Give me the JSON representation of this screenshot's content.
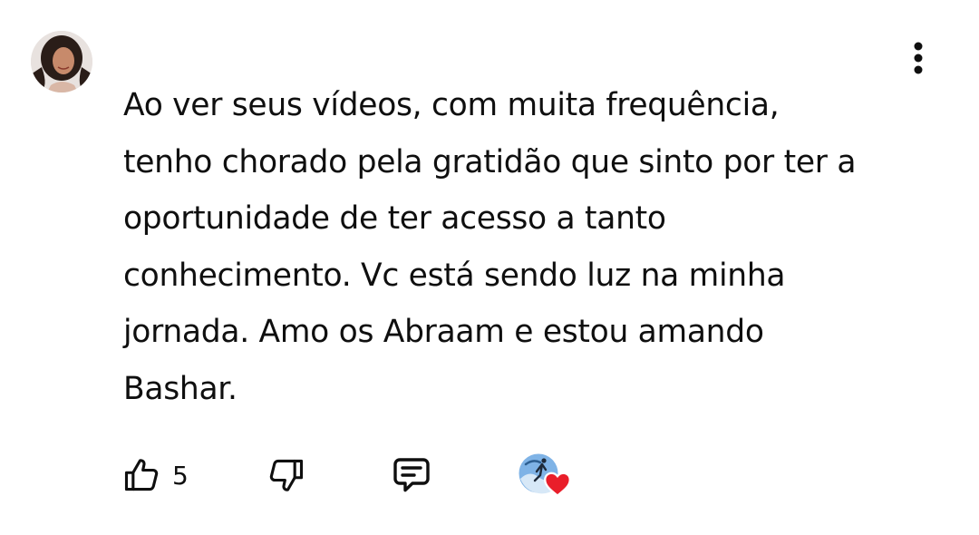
{
  "comment": {
    "text": "Ao ver seus vídeos, com muita frequência,\ntenho chorado pela gratidão que sinto por ter a\noportunidade de ter acesso a tanto\nconhecimento. Vc está sendo luz na minha\njornada. Amo os Abraam e estou amando\nBashar.",
    "like_count": "5"
  },
  "icons": {
    "avatar": "user-avatar",
    "more": "more-vertical-icon",
    "like": "thumbs-up-icon",
    "dislike": "thumbs-down-icon",
    "reply": "reply-comment-icon",
    "creator_heart": "creator-heart-icon"
  },
  "colors": {
    "text": "#0f0f0f",
    "heart": "#e91e2a",
    "background": "#ffffff"
  }
}
